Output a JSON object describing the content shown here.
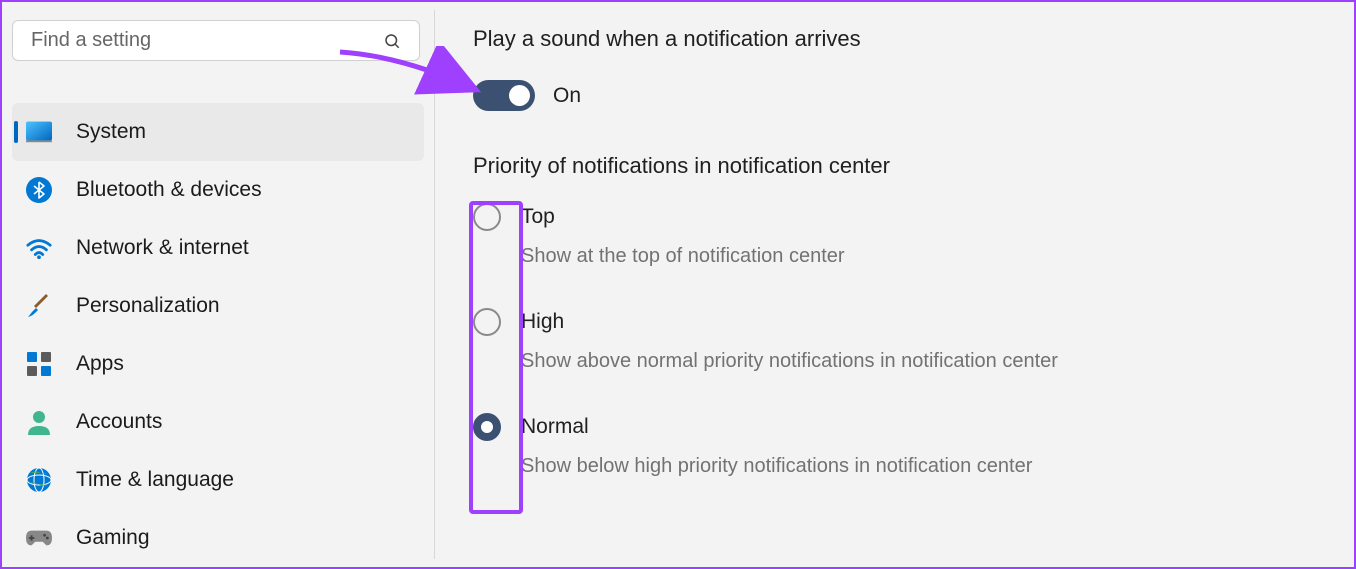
{
  "search": {
    "placeholder": "Find a setting"
  },
  "sidebar": {
    "items": [
      {
        "label": "System",
        "active": true
      },
      {
        "label": "Bluetooth & devices",
        "active": false
      },
      {
        "label": "Network & internet",
        "active": false
      },
      {
        "label": "Personalization",
        "active": false
      },
      {
        "label": "Apps",
        "active": false
      },
      {
        "label": "Accounts",
        "active": false
      },
      {
        "label": "Time & language",
        "active": false
      },
      {
        "label": "Gaming",
        "active": false
      }
    ]
  },
  "content": {
    "sound_label": "Play a sound when a notification arrives",
    "toggle_state": "On",
    "priority_label": "Priority of notifications in notification center",
    "options": [
      {
        "label": "Top",
        "desc": "Show at the top of notification center",
        "selected": false
      },
      {
        "label": "High",
        "desc": "Show above normal priority notifications in notification center",
        "selected": false
      },
      {
        "label": "Normal",
        "desc": "Show below high priority notifications in notification center",
        "selected": true
      }
    ]
  }
}
